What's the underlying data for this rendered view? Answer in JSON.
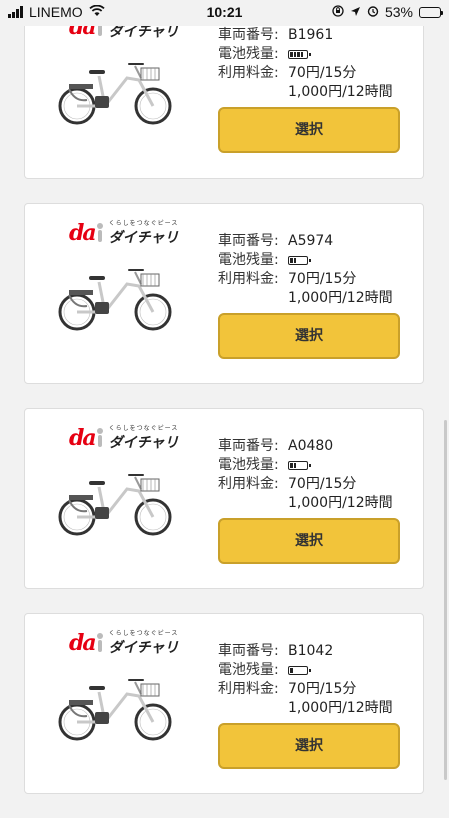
{
  "status_bar": {
    "carrier": "LINEMO",
    "time": "10:21",
    "battery_percent": "53%",
    "battery_level": 0.53,
    "icons": [
      "signal-icon",
      "wifi-icon",
      "rotation-lock-icon",
      "location-icon",
      "alarm-icon",
      "battery-icon"
    ]
  },
  "labels": {
    "bike_number": "車両番号:",
    "battery": "電池残量:",
    "fee": "利用料金:",
    "select": "選択"
  },
  "logo": {
    "da": "da",
    "tagline": "くらしをつなぐピース",
    "brand": "ダイチャリ"
  },
  "bikes": [
    {
      "number": "B1961",
      "battery_cells": 4,
      "fee_1": "70円/15分",
      "fee_2": "1,000円/12時間"
    },
    {
      "number": "A5974",
      "battery_cells": 2,
      "fee_1": "70円/15分",
      "fee_2": "1,000円/12時間"
    },
    {
      "number": "A0480",
      "battery_cells": 2,
      "fee_1": "70円/15分",
      "fee_2": "1,000円/12時間"
    },
    {
      "number": "B1042",
      "battery_cells": 1,
      "fee_1": "70円/15分",
      "fee_2": "1,000円/12時間"
    }
  ]
}
